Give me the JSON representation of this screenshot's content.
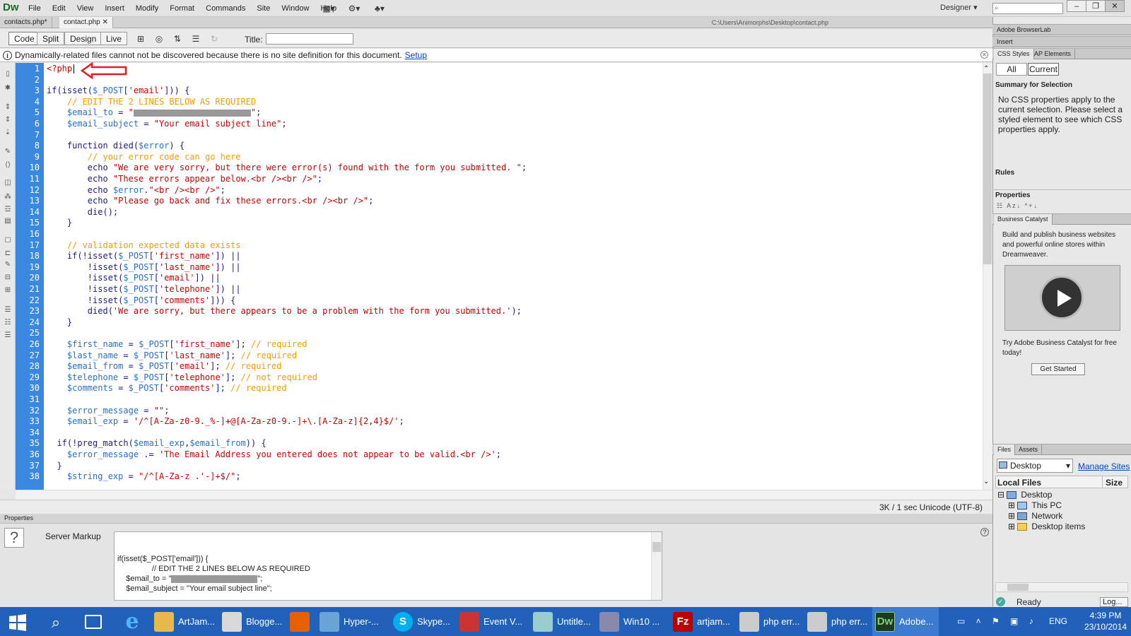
{
  "app": {
    "logo": "Dw",
    "menu": [
      "File",
      "Edit",
      "View",
      "Insert",
      "Modify",
      "Format",
      "Commands",
      "Site",
      "Window",
      "Help"
    ],
    "workspace": "Designer",
    "window_controls": [
      "–",
      "❐",
      "✕"
    ]
  },
  "doc_tabs": [
    {
      "label": "contacts.php*",
      "close": ""
    },
    {
      "label": "contact.php",
      "close": "✕"
    }
  ],
  "doc_path": "C:\\Users\\Animorphs\\Desktop\\contact.php",
  "doc_toolbar": {
    "views": [
      "Code",
      "Split",
      "Design",
      "Live"
    ],
    "title_label": "Title:",
    "title_value": ""
  },
  "info_bar": {
    "message": "Dynamically-related files cannot not be discovered because there is no site definition for this document.",
    "link": "Setup"
  },
  "code": {
    "first_line": 1,
    "lines": [
      [
        [
          "t",
          "<?php"
        ]
      ],
      [],
      [
        [
          "k",
          "if(isset("
        ],
        [
          "v",
          "$_POST"
        ],
        [
          "k",
          "["
        ],
        [
          "s",
          "'email'"
        ],
        [
          "k",
          "])) {"
        ]
      ],
      [
        [
          "c",
          "    // EDIT THE 2 LINES BELOW AS REQUIRED"
        ]
      ],
      [
        [
          "v",
          "    $email_to"
        ],
        [
          "k",
          " = "
        ],
        [
          "s",
          "\""
        ],
        [
          "redact",
          ""
        ],
        [
          "s",
          "\""
        ],
        [
          "k",
          ";"
        ]
      ],
      [
        [
          "v",
          "    $email_subject"
        ],
        [
          "k",
          " = "
        ],
        [
          "s",
          "\"Your email subject line\""
        ],
        [
          "k",
          ";"
        ]
      ],
      [],
      [
        [
          "k",
          "    function died("
        ],
        [
          "v",
          "$error"
        ],
        [
          "k",
          ") {"
        ]
      ],
      [
        [
          "c",
          "        // your error code can go here"
        ]
      ],
      [
        [
          "k",
          "        echo "
        ],
        [
          "s",
          "\"We are very sorry, but there were error(s) found with the form you submitted. \""
        ],
        [
          "k",
          ";"
        ]
      ],
      [
        [
          "k",
          "        echo "
        ],
        [
          "s",
          "\"These errors appear below.<br /><br />\""
        ],
        [
          "k",
          ";"
        ]
      ],
      [
        [
          "k",
          "        echo "
        ],
        [
          "v",
          "$error"
        ],
        [
          "k",
          "."
        ],
        [
          "s",
          "\"<br /><br />\""
        ],
        [
          "k",
          ";"
        ]
      ],
      [
        [
          "k",
          "        echo "
        ],
        [
          "s",
          "\"Please go back and fix these errors.<br /><br />\""
        ],
        [
          "k",
          ";"
        ]
      ],
      [
        [
          "k",
          "        die();"
        ]
      ],
      [
        [
          "k",
          "    }"
        ]
      ],
      [],
      [
        [
          "c",
          "    // validation expected data exists"
        ]
      ],
      [
        [
          "k",
          "    if(!isset("
        ],
        [
          "v",
          "$_POST"
        ],
        [
          "k",
          "["
        ],
        [
          "s",
          "'first_name'"
        ],
        [
          "k",
          "]) ||"
        ]
      ],
      [
        [
          "k",
          "        !isset("
        ],
        [
          "v",
          "$_POST"
        ],
        [
          "k",
          "["
        ],
        [
          "s",
          "'last_name'"
        ],
        [
          "k",
          "]) ||"
        ]
      ],
      [
        [
          "k",
          "        !isset("
        ],
        [
          "v",
          "$_POST"
        ],
        [
          "k",
          "["
        ],
        [
          "s",
          "'email'"
        ],
        [
          "k",
          "]) ||"
        ]
      ],
      [
        [
          "k",
          "        !isset("
        ],
        [
          "v",
          "$_POST"
        ],
        [
          "k",
          "["
        ],
        [
          "s",
          "'telephone'"
        ],
        [
          "k",
          "]) ||"
        ]
      ],
      [
        [
          "k",
          "        !isset("
        ],
        [
          "v",
          "$_POST"
        ],
        [
          "k",
          "["
        ],
        [
          "s",
          "'comments'"
        ],
        [
          "k",
          "])) {"
        ]
      ],
      [
        [
          "k",
          "        died("
        ],
        [
          "s",
          "'We are sorry, but there appears to be a problem with the form you submitted.'"
        ],
        [
          "k",
          ");"
        ]
      ],
      [
        [
          "k",
          "    }"
        ]
      ],
      [],
      [
        [
          "v",
          "    $first_name"
        ],
        [
          "k",
          " = "
        ],
        [
          "v",
          "$_POST"
        ],
        [
          "k",
          "["
        ],
        [
          "s",
          "'first_name'"
        ],
        [
          "k",
          "]; "
        ],
        [
          "c",
          "// required"
        ]
      ],
      [
        [
          "v",
          "    $last_name"
        ],
        [
          "k",
          " = "
        ],
        [
          "v",
          "$_POST"
        ],
        [
          "k",
          "["
        ],
        [
          "s",
          "'last_name'"
        ],
        [
          "k",
          "]; "
        ],
        [
          "c",
          "// required"
        ]
      ],
      [
        [
          "v",
          "    $email_from"
        ],
        [
          "k",
          " = "
        ],
        [
          "v",
          "$_POST"
        ],
        [
          "k",
          "["
        ],
        [
          "s",
          "'email'"
        ],
        [
          "k",
          "]; "
        ],
        [
          "c",
          "// required"
        ]
      ],
      [
        [
          "v",
          "    $telephone"
        ],
        [
          "k",
          " = "
        ],
        [
          "v",
          "$_POST"
        ],
        [
          "k",
          "["
        ],
        [
          "s",
          "'telephone'"
        ],
        [
          "k",
          "]; "
        ],
        [
          "c",
          "// not required"
        ]
      ],
      [
        [
          "v",
          "    $comments"
        ],
        [
          "k",
          " = "
        ],
        [
          "v",
          "$_POST"
        ],
        [
          "k",
          "["
        ],
        [
          "s",
          "'comments'"
        ],
        [
          "k",
          "]; "
        ],
        [
          "c",
          "// required"
        ]
      ],
      [],
      [
        [
          "v",
          "    $error_message"
        ],
        [
          "k",
          " = "
        ],
        [
          "s",
          "\"\""
        ],
        [
          "k",
          ";"
        ]
      ],
      [
        [
          "v",
          "    $email_exp"
        ],
        [
          "k",
          " = "
        ],
        [
          "s",
          "'/^[A-Za-z0-9._%-]+@[A-Za-z0-9.-]+\\.[A-Za-z]{2,4}$/'"
        ],
        [
          "k",
          ";"
        ]
      ],
      [],
      [
        [
          "k",
          "  if(!preg_match("
        ],
        [
          "v",
          "$email_exp"
        ],
        [
          "k",
          ","
        ],
        [
          "v",
          "$email_from"
        ],
        [
          "k",
          ")) {"
        ]
      ],
      [
        [
          "v",
          "    $error_message"
        ],
        [
          "k",
          " .= "
        ],
        [
          "s",
          "'The Email Address you entered does not appear to be valid.<br />'"
        ],
        [
          "k",
          ";"
        ]
      ],
      [
        [
          "k",
          "  }"
        ]
      ],
      [
        [
          "v",
          "    $string_exp"
        ],
        [
          "k",
          " = "
        ],
        [
          "s",
          "\"/^[A-Za-z .'-]+$/\""
        ],
        [
          "k",
          ";"
        ]
      ]
    ]
  },
  "status": "3K / 1 sec  Unicode (UTF-8)",
  "properties": {
    "title": "Properties",
    "label": "Server Markup",
    "help": "?",
    "markup_lines": [
      "if(isset($_POST['email'])) {",
      "                // EDIT THE 2 LINES BELOW AS REQUIRED",
      "    $email_to = \"",
      "    $email_subject = \"Your email subject line\";"
    ],
    "markup_tail": "\";"
  },
  "right": {
    "browserlab": "Adobe BrowserLab",
    "insert": "Insert",
    "css_tabs": [
      "CSS Styles",
      "AP Elements"
    ],
    "css_mode": [
      "All",
      "Current"
    ],
    "summary_title": "Summary for Selection",
    "summary_text": "No CSS properties apply to the current selection.  Please select a styled element to see which CSS properties apply.",
    "rules": "Rules",
    "properties": "Properties",
    "bc_tab": "Business Catalyst",
    "bc_text": "Build and publish business websites and powerful online stores within Dreamweaver.",
    "bc_try": "Try Adobe Business Catalyst for free today!",
    "bc_button": "Get Started",
    "files_tabs": [
      "Files",
      "Assets"
    ],
    "site": "Desktop",
    "manage": "Manage Sites",
    "local_files": "Local Files",
    "size": "Size",
    "tree": [
      "Desktop",
      "This PC",
      "Network",
      "Desktop items"
    ],
    "ready": "Ready",
    "log": "Log..."
  },
  "taskbar": {
    "items": [
      {
        "label": "ArtJam...",
        "icon": "folder-icon",
        "color": "#e8b84a"
      },
      {
        "label": "Blogge...",
        "icon": "chrome-icon",
        "color": "#d9d9d9"
      },
      {
        "label": "",
        "icon": "firefox-icon",
        "color": "#e66000"
      },
      {
        "label": "Hyper-...",
        "icon": "hyperv-icon",
        "color": "#6aa3d6"
      },
      {
        "label": "Skype...",
        "icon": "skype-icon",
        "color": "#00aff0"
      },
      {
        "label": "Event V...",
        "icon": "eventviewer-icon",
        "color": "#c33"
      },
      {
        "label": "Untitle...",
        "icon": "notepad-icon",
        "color": "#9cc"
      },
      {
        "label": "Win10 ...",
        "icon": "remote-icon",
        "color": "#88a"
      },
      {
        "label": "artjam...",
        "icon": "filezilla-icon",
        "color": "#b00"
      },
      {
        "label": "php err...",
        "icon": "paint-icon",
        "color": "#ccc"
      },
      {
        "label": "php err...",
        "icon": "paint-icon",
        "color": "#ccc"
      },
      {
        "label": "Adobe...",
        "icon": "dreamweaver-icon",
        "color": "#1e3a1e"
      }
    ],
    "lang": "ENG",
    "time": "4:39 PM",
    "date": "23/10/2014"
  }
}
